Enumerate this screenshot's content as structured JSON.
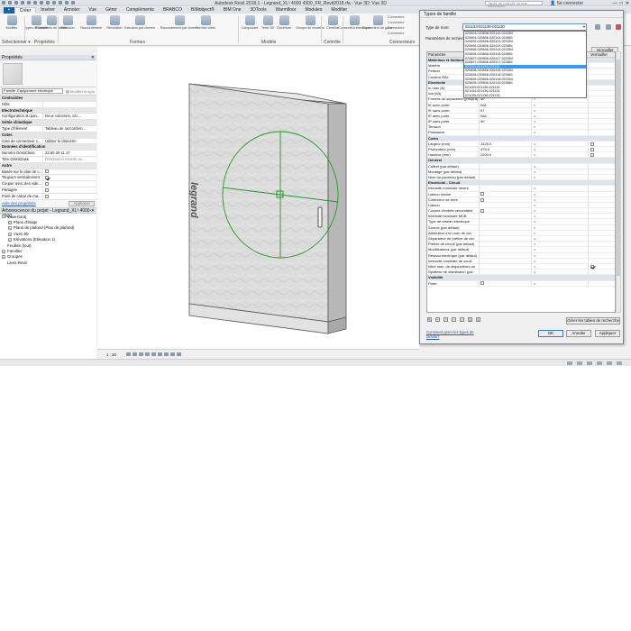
{
  "titlebar": {
    "title": "Autodesk Revit 2018.1 -   Legrand_XL³ 4000 4300_FR_Revit2018.rfa - Vue 3D: Vue 3D",
    "search_placeholder": "Tapez un mot-clé ou une expression",
    "signin": "Se connecter",
    "win_min": "—",
    "win_max": "□",
    "win_close": "✕"
  },
  "ribbon_tabs": [
    "Créer",
    "Insérer",
    "Annoter",
    "Vue",
    "Gérer",
    "Compléments",
    "BRABCO",
    "BIMobject®",
    "BIM One",
    "3DTools",
    "Warmfloor",
    "Modules",
    "Modifier"
  ],
  "ribbon": {
    "buttons": [
      "Modifier",
      "Types de famille",
      "Paramètres de famille",
      "Extrusion",
      "Raccordement",
      "Révolution",
      "Extrusion par chemin",
      "Raccordement par chemin",
      "Formes vides",
      "Composant",
      "Texte 3D",
      "Ouverture",
      "Groupe de modèles",
      "Contrôle",
      "Connecteur électrique",
      "Connecteur de gaine"
    ],
    "mini_items": [
      "Connecteur",
      "Connecteur",
      "Connecteur",
      "Connecteur"
    ],
    "panels": [
      "Sélectionner ▾",
      "Propriétés",
      "Formes",
      "Modèle",
      "Contrôle",
      "Connecteurs"
    ]
  },
  "properties_palette": {
    "title": "Propriétés",
    "close": "✕",
    "type_selector": "Famille: Equipement électrique",
    "edit_type": "Modifier le type",
    "rows": [
      {
        "group": true,
        "k": "Contraintes"
      },
      {
        "k": "Hôte",
        "v": "",
        "gray": true
      },
      {
        "group": true,
        "k": "Electrotechnique"
      },
      {
        "k": "Configuration du pan...",
        "v": "Deux colonnes, circ..."
      },
      {
        "group": true,
        "k": "Génie climatique"
      },
      {
        "k": "Type d'élément",
        "v": "Tableau de raccordem..."
      },
      {
        "group": true,
        "k": "Cotes"
      },
      {
        "k": "Cote de connecteur c...",
        "v": "Utiliser le diamètre"
      },
      {
        "group": true,
        "k": "Données d'identification"
      },
      {
        "k": "Numéro OmniClass",
        "v": "23.80.30.11.17"
      },
      {
        "k": "Titre OmniClass",
        "v": "Distribution Boards an...",
        "gray": true
      },
      {
        "group": true,
        "k": "Autre"
      },
      {
        "k": "Basée sur le plan de c...",
        "v": "",
        "cb": false
      },
      {
        "k": "Toujours verticalement",
        "v": "",
        "cb": true
      },
      {
        "k": "Couper avec des vide...",
        "v": "",
        "cb": false
      },
      {
        "k": "Partagée",
        "v": "",
        "cb": false
      },
      {
        "k": "Point de calcul de ma...",
        "v": "",
        "cb": false
      }
    ],
    "help_link": "Aide des propriétés",
    "apply": "Appliquer"
  },
  "project_browser": {
    "title": "Arborescence du projet - Legrand_XL³ 4000-4300_...",
    "close": "✕",
    "nodes": [
      {
        "label": "Vues (tout)",
        "level": 0,
        "toggle": "−"
      },
      {
        "label": "Plans d'étage",
        "level": 1,
        "toggle": "+"
      },
      {
        "label": "Plans de plafond (Plan de plafond)",
        "level": 1,
        "toggle": "+"
      },
      {
        "label": "Vues 3D",
        "level": 1,
        "toggle": "+"
      },
      {
        "label": "Elévations (Elévation 1)",
        "level": 1,
        "toggle": "+"
      },
      {
        "label": "Feuilles (tout)",
        "level": 0,
        "toggle": ""
      },
      {
        "label": "Familles",
        "level": 0,
        "toggle": "+"
      },
      {
        "label": "Groupes",
        "level": 0,
        "toggle": "+"
      },
      {
        "label": "Liens Revit",
        "level": 0,
        "toggle": ""
      }
    ]
  },
  "canvas": {
    "brand": "legrand"
  },
  "statusbar": {
    "scale": "1 : 20"
  },
  "dialog": {
    "title": "Types de famille",
    "type_name_label": "Type de nom:",
    "type_name_value": "021153-021136-021130",
    "type_name_arrow": "▾",
    "param_label": "Paramètres de recherche",
    "lock_button": "Verrouiller",
    "dropdown_options": [
      "020604-020806-020144-020354",
      "020604-020806-020144-020861",
      "020605-020806-020415-020354",
      "020606-020806-020415-020861",
      "020606-020806-020418-020354",
      "020606-020806-020418-020861",
      "020607-020806-020417-020354",
      "020607-020806-020417-020861",
      "021151-021136-021130",
      "020608-020806-020418-020354",
      "020608-020806-020418-020861",
      "020609-020806-020418-020354",
      "020609-020806-020418-020861",
      "021153-021136-021130",
      "021154-021136-021131",
      "021155-021136-021132"
    ],
    "selected_index": 8,
    "grid_header": [
      "Paramètre",
      "Valeur",
      "Formule",
      "Verrouiller"
    ],
    "grid_rows": [
      {
        "group": true,
        "c1": "Matériaux et finitions"
      },
      {
        "c1": "Matière",
        "c2": "",
        "c3": "=",
        "c4": ""
      },
      {
        "c1": "Finition",
        "c2": "",
        "c3": "=",
        "c4": ""
      },
      {
        "c1": "Couleur RAL",
        "c2": "",
        "c3": "=",
        "c4": ""
      },
      {
        "group": true,
        "c1": "Electricité"
      },
      {
        "c1": "In max (A)",
        "c2": "",
        "c3": "=",
        "c4": ""
      },
      {
        "c1": "Icw (kA)",
        "c2": "",
        "c3": "=",
        "c4": ""
      },
      {
        "c1": "Formes de séparation (jusqu'à)",
        "c2": "4b",
        "c3": "=",
        "c4": ""
      },
      {
        "c1": "IK avec porte",
        "c2": "N/A",
        "c3": "=",
        "c4": ""
      },
      {
        "c1": "IK sans porte",
        "c2": "07",
        "c3": "=",
        "c4": ""
      },
      {
        "c1": "IP avec porte",
        "c2": "N/A",
        "c3": "=",
        "c4": ""
      },
      {
        "c1": "IP sans porte",
        "c2": "30",
        "c3": "=",
        "c4": ""
      },
      {
        "c1": "Tension",
        "c2": "",
        "c3": "=",
        "c4": ""
      },
      {
        "c1": "Puissance",
        "c2": "",
        "c3": "=",
        "c4": ""
      },
      {
        "group": true,
        "c1": "Cotes"
      },
      {
        "c1": "Largeur (mm)",
        "c2": "1425.0",
        "c3": "=",
        "c4": "cb"
      },
      {
        "c1": "Profondeur (mm)",
        "c2": "475.0",
        "c3": "=",
        "c4": "cb"
      },
      {
        "c1": "Hauteur (mm)",
        "c2": "2200.0",
        "c3": "=",
        "c4": "cb"
      },
      {
        "group": true,
        "c1": "Général"
      },
      {
        "c1": "Coffret (par défaut)",
        "c2": "",
        "c3": "=",
        "c4": ""
      },
      {
        "c1": "Montage (par défaut)",
        "c2": "",
        "c3": "=",
        "c4": ""
      },
      {
        "c1": "Nom du panneau (par défaut)",
        "c2": "",
        "c3": "=",
        "c4": ""
      },
      {
        "group": true,
        "c1": "Electricité - Circuit"
      },
      {
        "c1": "Intensité nominale neutre",
        "c2": "",
        "c3": "=",
        "c4": ""
      },
      {
        "c1": "Liaison neutre",
        "c2": "cb",
        "c3": "=",
        "c4": ""
      },
      {
        "c1": "Collecteur de terre",
        "c2": "cb",
        "c3": "=",
        "c4": ""
      },
      {
        "c1": "Liaison",
        "c2": "",
        "c3": "=",
        "c4": ""
      },
      {
        "c1": "Cosses d'entrée secondaire",
        "c2": "cb",
        "c3": "=",
        "c4": ""
      },
      {
        "c1": "Intensité nominale MCB",
        "c2": "",
        "c3": "=",
        "c4": ""
      },
      {
        "c1": "Type de réseau électrique",
        "c2": "",
        "c3": "=",
        "c4": ""
      },
      {
        "c1": "Source (par défaut)",
        "c2": "",
        "c3": "=",
        "c4": ""
      },
      {
        "c1": "Attribution d'un nom de circ",
        "c2": "",
        "c3": "=",
        "c4": ""
      },
      {
        "c1": "Séparateur de préfixe de circ",
        "c2": "",
        "c3": "=",
        "c4": ""
      },
      {
        "c1": "Préfixe de circuit (par défaut)",
        "c2": "",
        "c3": "=",
        "c4": ""
      },
      {
        "c1": "Modifications (par défaut)",
        "c2": "",
        "c3": "=",
        "c4": ""
      },
      {
        "c1": "Réseau électrique (par défaut)",
        "c2": "",
        "c3": "=",
        "c4": ""
      },
      {
        "c1": "Intensité nominale de court-",
        "c2": "",
        "c3": "=",
        "c4": ""
      },
      {
        "c1": "Nbre max. de disjoncteurs un",
        "c2": "",
        "c3": "=",
        "c4": "cbon"
      },
      {
        "c1": "Système de distribution (par",
        "c2": "",
        "c3": "=",
        "c4": ""
      },
      {
        "group": true,
        "c1": "Visibilité"
      },
      {
        "c1": "Porte",
        "c2": "cb",
        "c3": "=",
        "c4": ""
      }
    ],
    "manage_lookup": "Gérer les tables de recherche",
    "help_link": "Comment gérer les types de famille?",
    "ok": "OK",
    "cancel": "Annuler",
    "apply": "Appliquer"
  },
  "colors": {
    "accent": "#1f5fa8",
    "selection": "#3399ff",
    "guide_green": "#1f9a1f"
  }
}
